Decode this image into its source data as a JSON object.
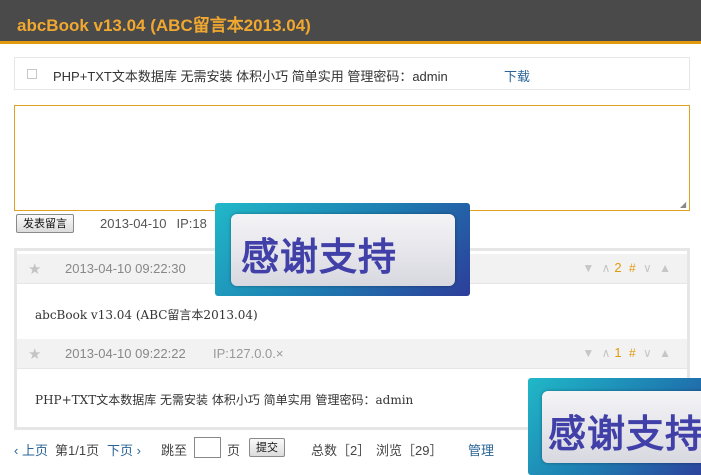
{
  "app": {
    "title": "abcBook v13.04 (ABC留言本2013.04)"
  },
  "notice": {
    "text": "PHP+TXT文本数据库 无需安装 体积小巧 简单实用 管理密码：admin",
    "download_label": "下载"
  },
  "composer": {
    "value": "",
    "submit_label": "发表留言",
    "date": "2013-04-10",
    "ip_prefix": "IP:18"
  },
  "messages": [
    {
      "time": "2013-04-10 09:22:30",
      "ip": "",
      "count": "2",
      "marker": "#",
      "body": "abcBook v13.04 (ABC留言本2013.04)"
    },
    {
      "time": "2013-04-10 09:22:22",
      "ip": "IP:127.0.0.×",
      "count": "1",
      "marker": "#",
      "body": "PHP+TXT文本数据库 无需安装 体积小巧 简单实用 管理密码：admin"
    }
  ],
  "vote_icons": {
    "down": "▼",
    "up_outline": "∧",
    "down_outline": "∨",
    "up": "▲",
    "star": "★"
  },
  "promo": {
    "text": "感谢支持"
  },
  "pager": {
    "prev_label": "‹ 上页",
    "page_info": "第1/1页",
    "next_label": "下页 ›",
    "jump_label": "跳至",
    "jump_value": "",
    "page_unit": "页",
    "submit_label": "提交",
    "total": "总数［2］",
    "views": "浏览［29］",
    "admin_label": "管理"
  },
  "colors": {
    "accent": "#e09a10",
    "header_bg": "#4a4a4a",
    "link": "#2a6496"
  }
}
